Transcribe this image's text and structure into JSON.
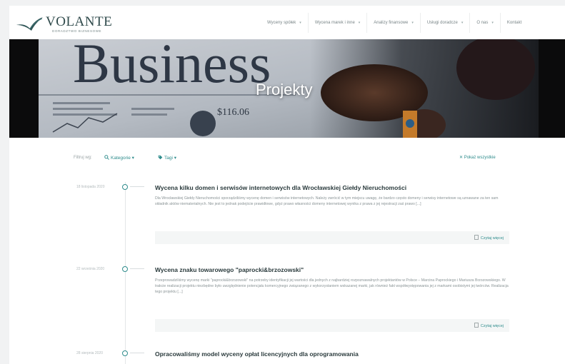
{
  "brand": {
    "name": "VOLANTE",
    "tagline": "DORADZTWO BIZNESOWE"
  },
  "nav": [
    {
      "label": "Wyceny spółek",
      "caret": "▾"
    },
    {
      "label": "Wycena marek i inne",
      "caret": "▾"
    },
    {
      "label": "Analizy finansowe",
      "caret": "▾"
    },
    {
      "label": "Usługi doradcze",
      "caret": "▾"
    },
    {
      "label": "O nas",
      "caret": "▾"
    },
    {
      "label": "Kontakt",
      "caret": ""
    }
  ],
  "hero": {
    "title": "Projekty",
    "image_text": "Business",
    "price_text": "$116.06"
  },
  "filters": {
    "label": "Filtruj wg:",
    "category": "Kategorie ▾",
    "tags": "Tagi ▾",
    "show_all": "✕ Pokaż wszystkie"
  },
  "posts": [
    {
      "date": "18 listopada 2020",
      "title": "Wycena kilku domen i serwisów internetowych dla Wrocławskiej Giełdy Nieruchomości",
      "excerpt": "Dla Wrocławskiej Giełdy Nieruchomości sporządziliśmy wycenę domen i serwisów internetowych. Należy zwrócić w tym miejscu uwagę, że bardzo często domeny i serwisy internetowe są uznawane za ten sam składnik aktów niematerialnych. Nie jest to jednak podejście prawidłowe, gdyż prawo własności domeny internetowej wynika z prawa z jej rejestracji zaś prawo [...]",
      "more": "Czytaj więcej"
    },
    {
      "date": "22 września 2020",
      "title": "Wycena znaku towarowego \"paprocki&brzozowski\"",
      "excerpt": "Przeprowadziliśmy wycenę marki \"paprocki&brzozowski\" na potrzeby identyfikacji jej wartości dla jednych z najbardziej rozpoznawalnych projektantów w Polsce – Marcina Paprockiego i Mariusza Brzozowskiego. W trakcie realizacji projektu niezbędne było uwzględnienie potencjału komercyjnego związanego z wykorzystaniem wskazanej marki, jak również fakt współwystępowania jej z markami osobistymi jej twórców. Realizacja tego projektu [...]",
      "more": "Czytaj więcej"
    },
    {
      "date": "28 sierpnia 2020",
      "title": "Opracowaliśmy model wyceny opłat licencyjnych dla oprogramowania",
      "excerpt": "",
      "more": ""
    }
  ],
  "colors": {
    "accent": "#2e8c8c",
    "brand": "#2f4a4b"
  }
}
